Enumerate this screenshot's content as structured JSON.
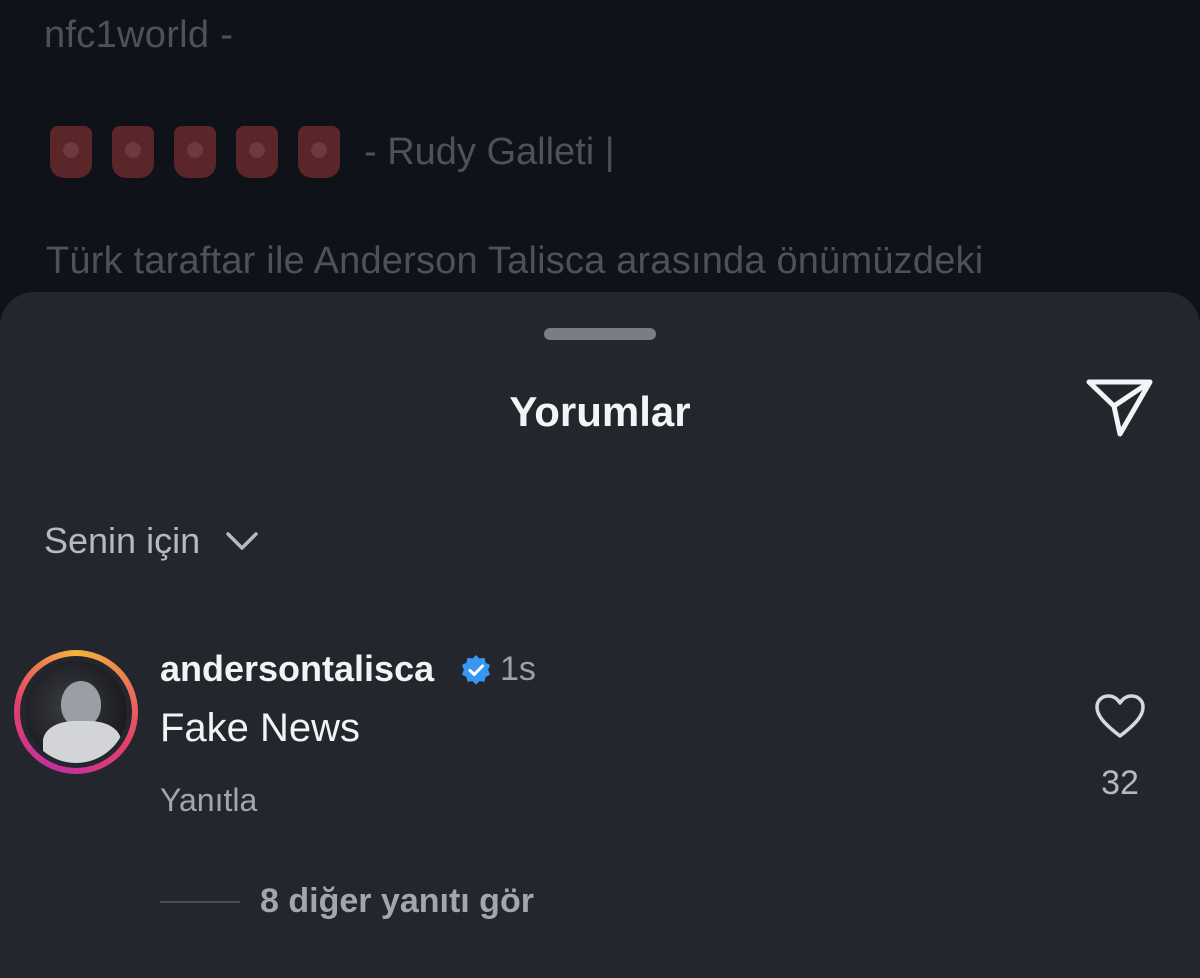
{
  "background_post": {
    "username": "nfc1world -",
    "credit": "- Rudy Galleti |",
    "emoji_count": 5,
    "caption_preview": "Türk taraftar ile Anderson Talisca arasında önümüzdeki"
  },
  "sheet": {
    "title": "Yorumlar",
    "share_icon": "paper-plane-icon",
    "filter_label": "Senin için",
    "filter_icon": "chevron-down-icon"
  },
  "comment": {
    "username": "andersontalisca",
    "verified": true,
    "time": "1s",
    "text": "Fake News",
    "reply_label": "Yanıtla",
    "like_count": "32",
    "more_replies_label": "8 diğer yanıtı gör"
  },
  "colors": {
    "sheet_bg": "#24262d",
    "verified_blue": "#3897f0",
    "ring_gradient": [
      "#f4b43c",
      "#e4406a",
      "#c22fa0"
    ]
  }
}
